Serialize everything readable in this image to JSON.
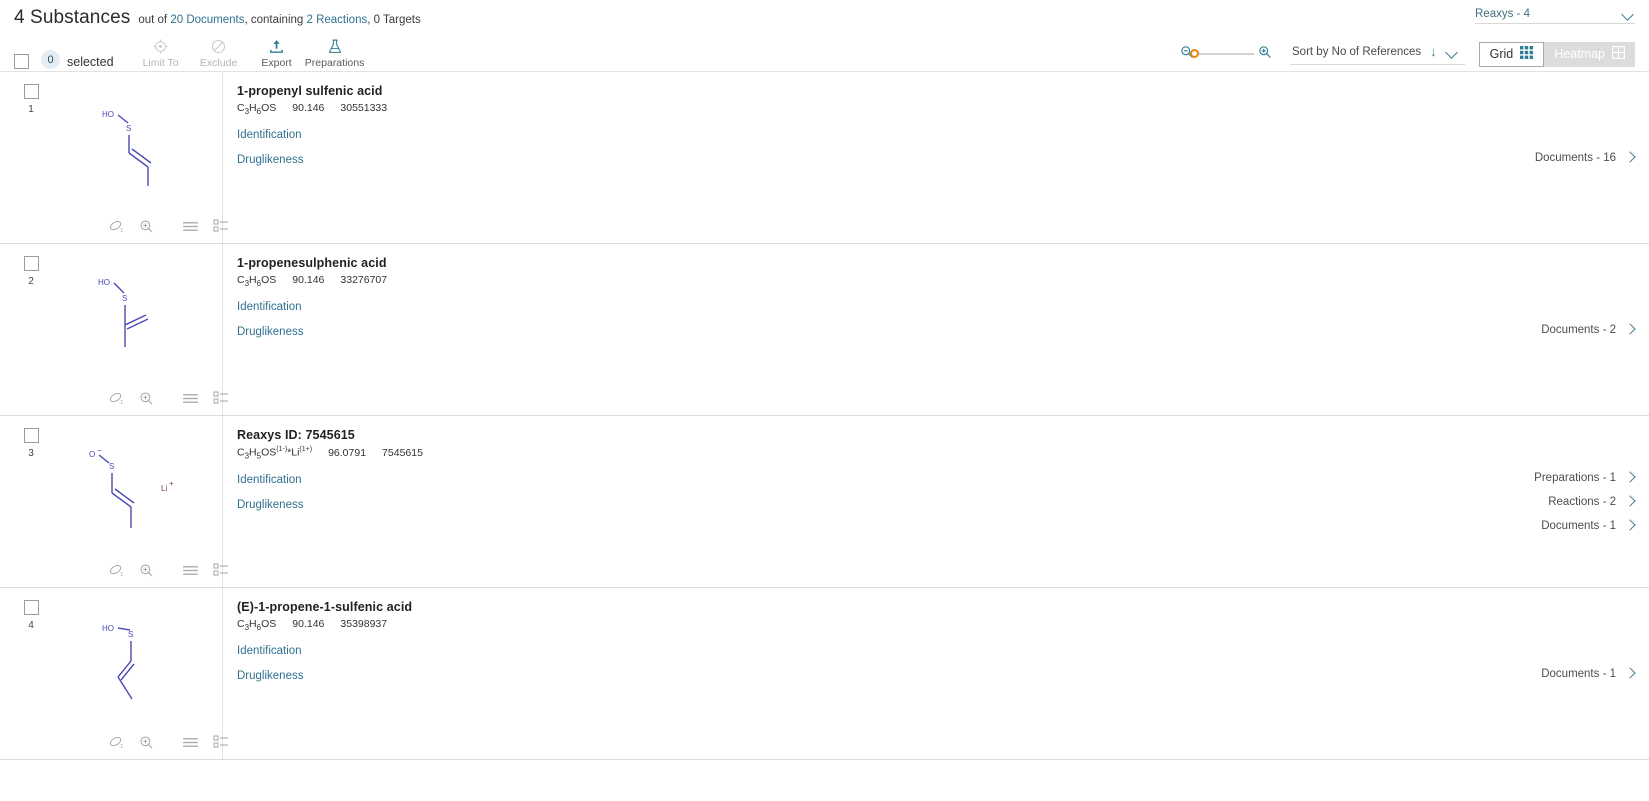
{
  "header": {
    "count_label": "4 Substances",
    "out_of_prefix": "out of",
    "documents_link": "20 Documents",
    "containing_text": ", containing ",
    "reactions_link": "2 Reactions",
    "targets_text": ", 0 Targets",
    "source_select": "Reaxys - 4"
  },
  "toolbar": {
    "selected_count": "0",
    "selected_label": "selected",
    "actions": [
      {
        "label": "Limit To",
        "icon": "target-icon",
        "disabled": true
      },
      {
        "label": "Exclude",
        "icon": "no-entry-icon",
        "disabled": true
      },
      {
        "label": "Export",
        "icon": "upload-icon",
        "disabled": false
      },
      {
        "label": "Preparations",
        "icon": "flask-icon",
        "disabled": false
      }
    ],
    "sort_label": "Sort by No of References",
    "view_grid": "Grid",
    "view_heatmap": "Heatmap"
  },
  "rows": [
    {
      "index": "1",
      "name": "1-propenyl sulfenic acid",
      "formula_html": "C<sub>3</sub>H<sub>6</sub>OS",
      "mass": "90.146",
      "id": "30551333",
      "facts": [
        "Identification",
        "Druglikeness"
      ],
      "links": [
        {
          "label": "Documents - 16"
        }
      ],
      "structure": "propenyl-sulfenic-acid"
    },
    {
      "index": "2",
      "name": "1-propenesulphenic acid",
      "formula_html": "C<sub>3</sub>H<sub>6</sub>OS",
      "mass": "90.146",
      "id": "33276707",
      "facts": [
        "Identification",
        "Druglikeness"
      ],
      "links": [
        {
          "label": "Documents - 2"
        }
      ],
      "structure": "propenesulphenic-acid"
    },
    {
      "index": "3",
      "name": "Reaxys ID: 7545615",
      "formula_html": "C<sub>3</sub>H<sub>5</sub>OS<sup>(1-)</sup>*Li<sup>(1+)</sup>",
      "mass": "96.0791",
      "id": "7545615",
      "facts": [
        "Identification",
        "Druglikeness"
      ],
      "links": [
        {
          "label": "Preparations - 1"
        },
        {
          "label": "Reactions - 2"
        },
        {
          "label": "Documents - 1"
        }
      ],
      "structure": "lithium-propenesulfenate"
    },
    {
      "index": "4",
      "name": "(E)-1-propene-1-sulfenic acid",
      "formula_html": "C<sub>3</sub>H<sub>6</sub>OS",
      "mass": "90.146",
      "id": "35398937",
      "facts": [
        "Identification",
        "Druglikeness"
      ],
      "links": [
        {
          "label": "Documents - 1"
        }
      ],
      "structure": "e-propene-sulfenic-acid"
    }
  ],
  "structure_tools": [
    "copy-structure-icon",
    "zoom-structure-icon",
    "list-view-icon",
    "tree-view-icon"
  ],
  "colors": {
    "link": "#31708f",
    "accent_orange": "#e8830c",
    "teal": "#3d7d91",
    "structure_blue": "#4a4ab4",
    "ion_brown": "#7a4a3a"
  }
}
